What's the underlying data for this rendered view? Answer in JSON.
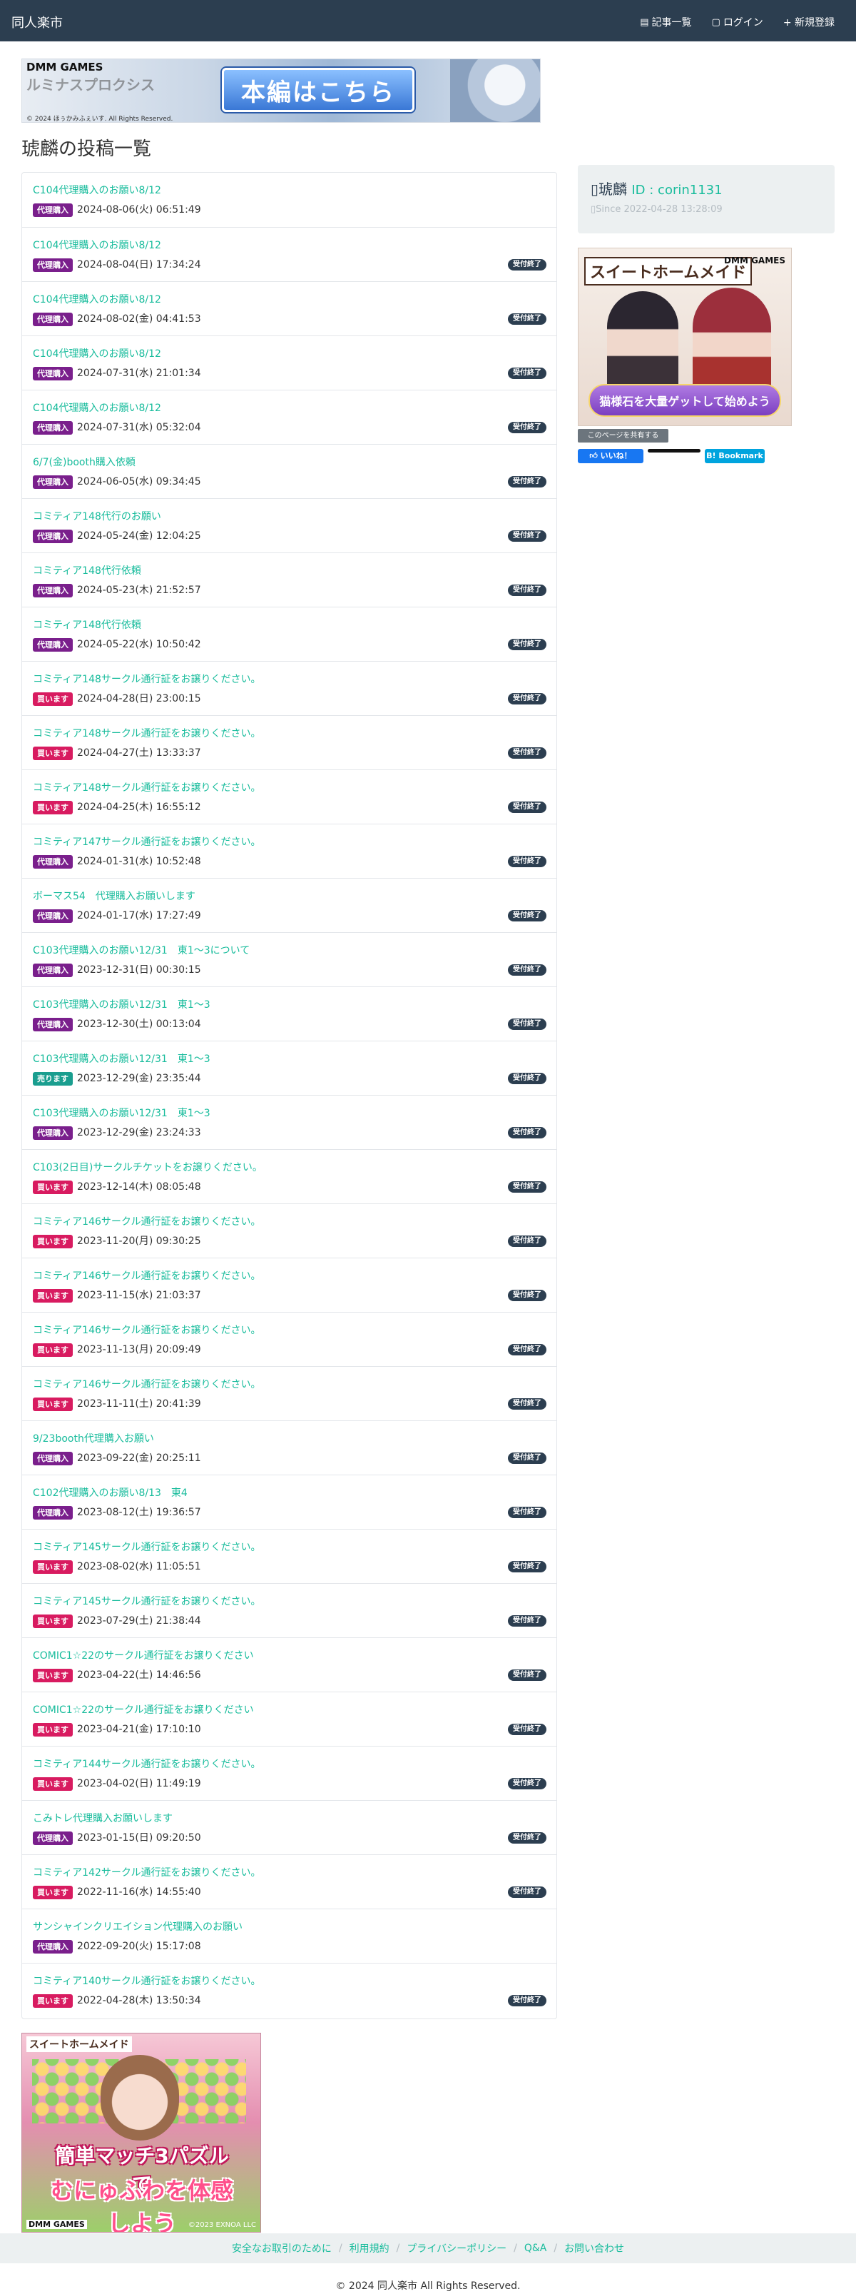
{
  "nav": {
    "brand": "同人楽市",
    "articles": "記事一覧",
    "login": "ログイン",
    "register": "+ 新規登録"
  },
  "banner_top": {
    "logo": "DMM GAMES",
    "game": "ルミナスプロクシス",
    "copyright": "© 2024 ほぅかみふぇいす. All Rights Reserved.",
    "cta": "本編はこちら"
  },
  "page_title": "琥麟の投稿一覧",
  "posts": [
    {
      "title": "C104代理購入のお願い8/12",
      "tag": "代理購入",
      "kind": "buy",
      "date": "2024-08-06(火) 06:51:49",
      "status": ""
    },
    {
      "title": "C104代理購入のお願い8/12",
      "tag": "代理購入",
      "kind": "buy",
      "date": "2024-08-04(日) 17:34:24",
      "status": "受付終了"
    },
    {
      "title": "C104代理購入のお願い8/12",
      "tag": "代理購入",
      "kind": "buy",
      "date": "2024-08-02(金) 04:41:53",
      "status": "受付終了"
    },
    {
      "title": "C104代理購入のお願い8/12",
      "tag": "代理購入",
      "kind": "buy",
      "date": "2024-07-31(水) 21:01:34",
      "status": "受付終了"
    },
    {
      "title": "C104代理購入のお願い8/12",
      "tag": "代理購入",
      "kind": "buy",
      "date": "2024-07-31(水) 05:32:04",
      "status": "受付終了"
    },
    {
      "title": "6/7(金)booth購入依頼",
      "tag": "代理購入",
      "kind": "buy",
      "date": "2024-06-05(水) 09:34:45",
      "status": "受付終了"
    },
    {
      "title": "コミティア148代行のお願い",
      "tag": "代理購入",
      "kind": "buy",
      "date": "2024-05-24(金) 12:04:25",
      "status": "受付終了"
    },
    {
      "title": "コミティア148代行依頼",
      "tag": "代理購入",
      "kind": "buy",
      "date": "2024-05-23(木) 21:52:57",
      "status": "受付終了"
    },
    {
      "title": "コミティア148代行依頼",
      "tag": "代理購入",
      "kind": "buy",
      "date": "2024-05-22(水) 10:50:42",
      "status": "受付終了"
    },
    {
      "title": "コミティア148サークル通行証をお譲りください。",
      "tag": "買います",
      "kind": "want",
      "date": "2024-04-28(日) 23:00:15",
      "status": "受付終了"
    },
    {
      "title": "コミティア148サークル通行証をお譲りください。",
      "tag": "買います",
      "kind": "want",
      "date": "2024-04-27(土) 13:33:37",
      "status": "受付終了"
    },
    {
      "title": "コミティア148サークル通行証をお譲りください。",
      "tag": "買います",
      "kind": "want",
      "date": "2024-04-25(木) 16:55:12",
      "status": "受付終了"
    },
    {
      "title": "コミティア147サークル通行証をお譲りください。",
      "tag": "代理購入",
      "kind": "buy",
      "date": "2024-01-31(水) 10:52:48",
      "status": "受付終了"
    },
    {
      "title": "ボーマス54　代理購入お願いします",
      "tag": "代理購入",
      "kind": "buy",
      "date": "2024-01-17(水) 17:27:49",
      "status": "受付終了"
    },
    {
      "title": "C103代理購入のお願い12/31　東1～3について",
      "tag": "代理購入",
      "kind": "buy",
      "date": "2023-12-31(日) 00:30:15",
      "status": "受付終了"
    },
    {
      "title": "C103代理購入のお願い12/31　東1～3",
      "tag": "代理購入",
      "kind": "buy",
      "date": "2023-12-30(土) 00:13:04",
      "status": "受付終了"
    },
    {
      "title": "C103代理購入のお願い12/31　東1～3",
      "tag": "売ります",
      "kind": "sell",
      "date": "2023-12-29(金) 23:35:44",
      "status": "受付終了"
    },
    {
      "title": "C103代理購入のお願い12/31　東1～3",
      "tag": "代理購入",
      "kind": "buy",
      "date": "2023-12-29(金) 23:24:33",
      "status": "受付終了"
    },
    {
      "title": "C103(2日目)サークルチケットをお譲りください。",
      "tag": "買います",
      "kind": "want",
      "date": "2023-12-14(木) 08:05:48",
      "status": "受付終了"
    },
    {
      "title": "コミティア146サークル通行証をお譲りください。",
      "tag": "買います",
      "kind": "want",
      "date": "2023-11-20(月) 09:30:25",
      "status": "受付終了"
    },
    {
      "title": "コミティア146サークル通行証をお譲りください。",
      "tag": "買います",
      "kind": "want",
      "date": "2023-11-15(水) 21:03:37",
      "status": "受付終了"
    },
    {
      "title": "コミティア146サークル通行証をお譲りください。",
      "tag": "買います",
      "kind": "want",
      "date": "2023-11-13(月) 20:09:49",
      "status": "受付終了"
    },
    {
      "title": "コミティア146サークル通行証をお譲りください。",
      "tag": "買います",
      "kind": "want",
      "date": "2023-11-11(土) 20:41:39",
      "status": "受付終了"
    },
    {
      "title": "9/23booth代理購入お願い",
      "tag": "代理購入",
      "kind": "buy",
      "date": "2023-09-22(金) 20:25:11",
      "status": "受付終了"
    },
    {
      "title": "C102代理購入のお願い8/13　東4",
      "tag": "代理購入",
      "kind": "buy",
      "date": "2023-08-12(土) 19:36:57",
      "status": "受付終了"
    },
    {
      "title": "コミティア145サークル通行証をお譲りください。",
      "tag": "買います",
      "kind": "want",
      "date": "2023-08-02(水) 11:05:51",
      "status": "受付終了"
    },
    {
      "title": "コミティア145サークル通行証をお譲りください。",
      "tag": "買います",
      "kind": "want",
      "date": "2023-07-29(土) 21:38:44",
      "status": "受付終了"
    },
    {
      "title": "COMIC1☆22のサークル通行証をお譲りください",
      "tag": "買います",
      "kind": "want",
      "date": "2023-04-22(土) 14:46:56",
      "status": "受付終了"
    },
    {
      "title": "COMIC1☆22のサークル通行証をお譲りください",
      "tag": "買います",
      "kind": "want",
      "date": "2023-04-21(金) 17:10:10",
      "status": "受付終了"
    },
    {
      "title": "コミティア144サークル通行証をお譲りください。",
      "tag": "買います",
      "kind": "want",
      "date": "2023-04-02(日) 11:49:19",
      "status": "受付終了"
    },
    {
      "title": "こみトレ代理購入お願いします",
      "tag": "代理購入",
      "kind": "buy",
      "date": "2023-01-15(日) 09:20:50",
      "status": "受付終了"
    },
    {
      "title": "コミティア142サークル通行証をお譲りください。",
      "tag": "買います",
      "kind": "want",
      "date": "2022-11-16(水) 14:55:40",
      "status": "受付終了"
    },
    {
      "title": "サンシャインクリエイション代理購入のお願い",
      "tag": "代理購入",
      "kind": "buy",
      "date": "2022-09-20(火) 15:17:08",
      "status": ""
    },
    {
      "title": "コミティア140サークル通行証をお譲りください。",
      "tag": "買います",
      "kind": "want",
      "date": "2022-04-28(木) 13:50:34",
      "status": "受付終了"
    }
  ],
  "profile": {
    "name": "琥麟",
    "id_label": "ID : corin1131",
    "since": "Since 2022-04-28 13:28:09"
  },
  "ad_side": {
    "title": "スイートホームメイド",
    "logo": "DMM GAMES",
    "cta": "猫様石を大量ゲットして始めよう"
  },
  "share": {
    "label": "このページを共有する",
    "like": "いいね！",
    "bookmark": "B! Bookmark"
  },
  "ad_bottom": {
    "title": "スイートホームメイド",
    "line1": "簡単マッチ3パズルで",
    "line2": "むにゅふわを体感しよう",
    "logo": "DMM GAMES",
    "copyright": "©2023 EXNOA LLC"
  },
  "footer": {
    "links": [
      "安全なお取引のために",
      "利用規約",
      "プライバシーポリシー",
      "Q&A",
      "お問い合わせ"
    ],
    "copyright": "© 2024 同人楽市 All Rights Reserved."
  },
  "colors": {
    "navbar": "#2c3e50",
    "link": "#18bc9c",
    "tag_buy": "#7a1f8c",
    "tag_want": "#d81b60",
    "tag_sell": "#1a9e8f",
    "status_badge": "#2c3e50"
  }
}
